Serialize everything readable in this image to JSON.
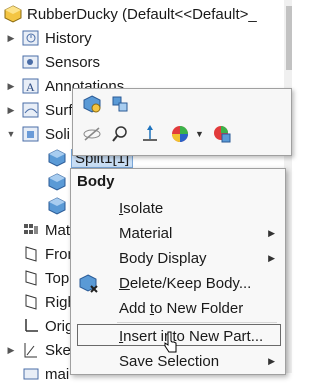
{
  "tree": {
    "title": "RubberDucky  (Default<<Default>_",
    "items": [
      {
        "label": "History"
      },
      {
        "label": "Sensors"
      },
      {
        "label": "Annotations"
      },
      {
        "label": "Surf"
      },
      {
        "label": "Soli"
      },
      {
        "label": "Split1[1]"
      },
      {
        "label": "Mat"
      },
      {
        "label": "Fron"
      },
      {
        "label": "Top"
      },
      {
        "label": "Righ"
      },
      {
        "label": "Orig"
      },
      {
        "label": "Ske"
      },
      {
        "label": "mai"
      }
    ]
  },
  "context_menu": {
    "header": "Body",
    "items": [
      {
        "pre": "",
        "u": "I",
        "post": "solate",
        "submenu": false
      },
      {
        "pre": "Material",
        "u": "",
        "post": "",
        "submenu": true
      },
      {
        "pre": "Body Display",
        "u": "",
        "post": "",
        "submenu": true
      },
      {
        "pre": "",
        "u": "D",
        "post": "elete/Keep Body...",
        "submenu": false
      },
      {
        "pre": "Add ",
        "u": "t",
        "post": "o New Folder",
        "submenu": false
      },
      {
        "pre": "",
        "u": "I",
        "post": "nsert into New Part...",
        "submenu": false
      },
      {
        "pre": "Save Selection",
        "u": "",
        "post": "",
        "submenu": true
      }
    ],
    "highlighted_index": 5
  },
  "colors": {
    "accent": "#1e73be",
    "highlight_border": "#6a6a6a"
  },
  "icons": [
    "part-icon",
    "history-icon",
    "sensors-icon",
    "annotations-icon",
    "surface-bodies-icon",
    "solid-bodies-icon",
    "body-icon",
    "material-icon",
    "plane-icon",
    "origin-icon",
    "sketch-icon",
    "zoom-icon",
    "normal-to-icon",
    "appearance-icon",
    "hide-icon",
    "delete-body-icon",
    "cursor-icon"
  ]
}
